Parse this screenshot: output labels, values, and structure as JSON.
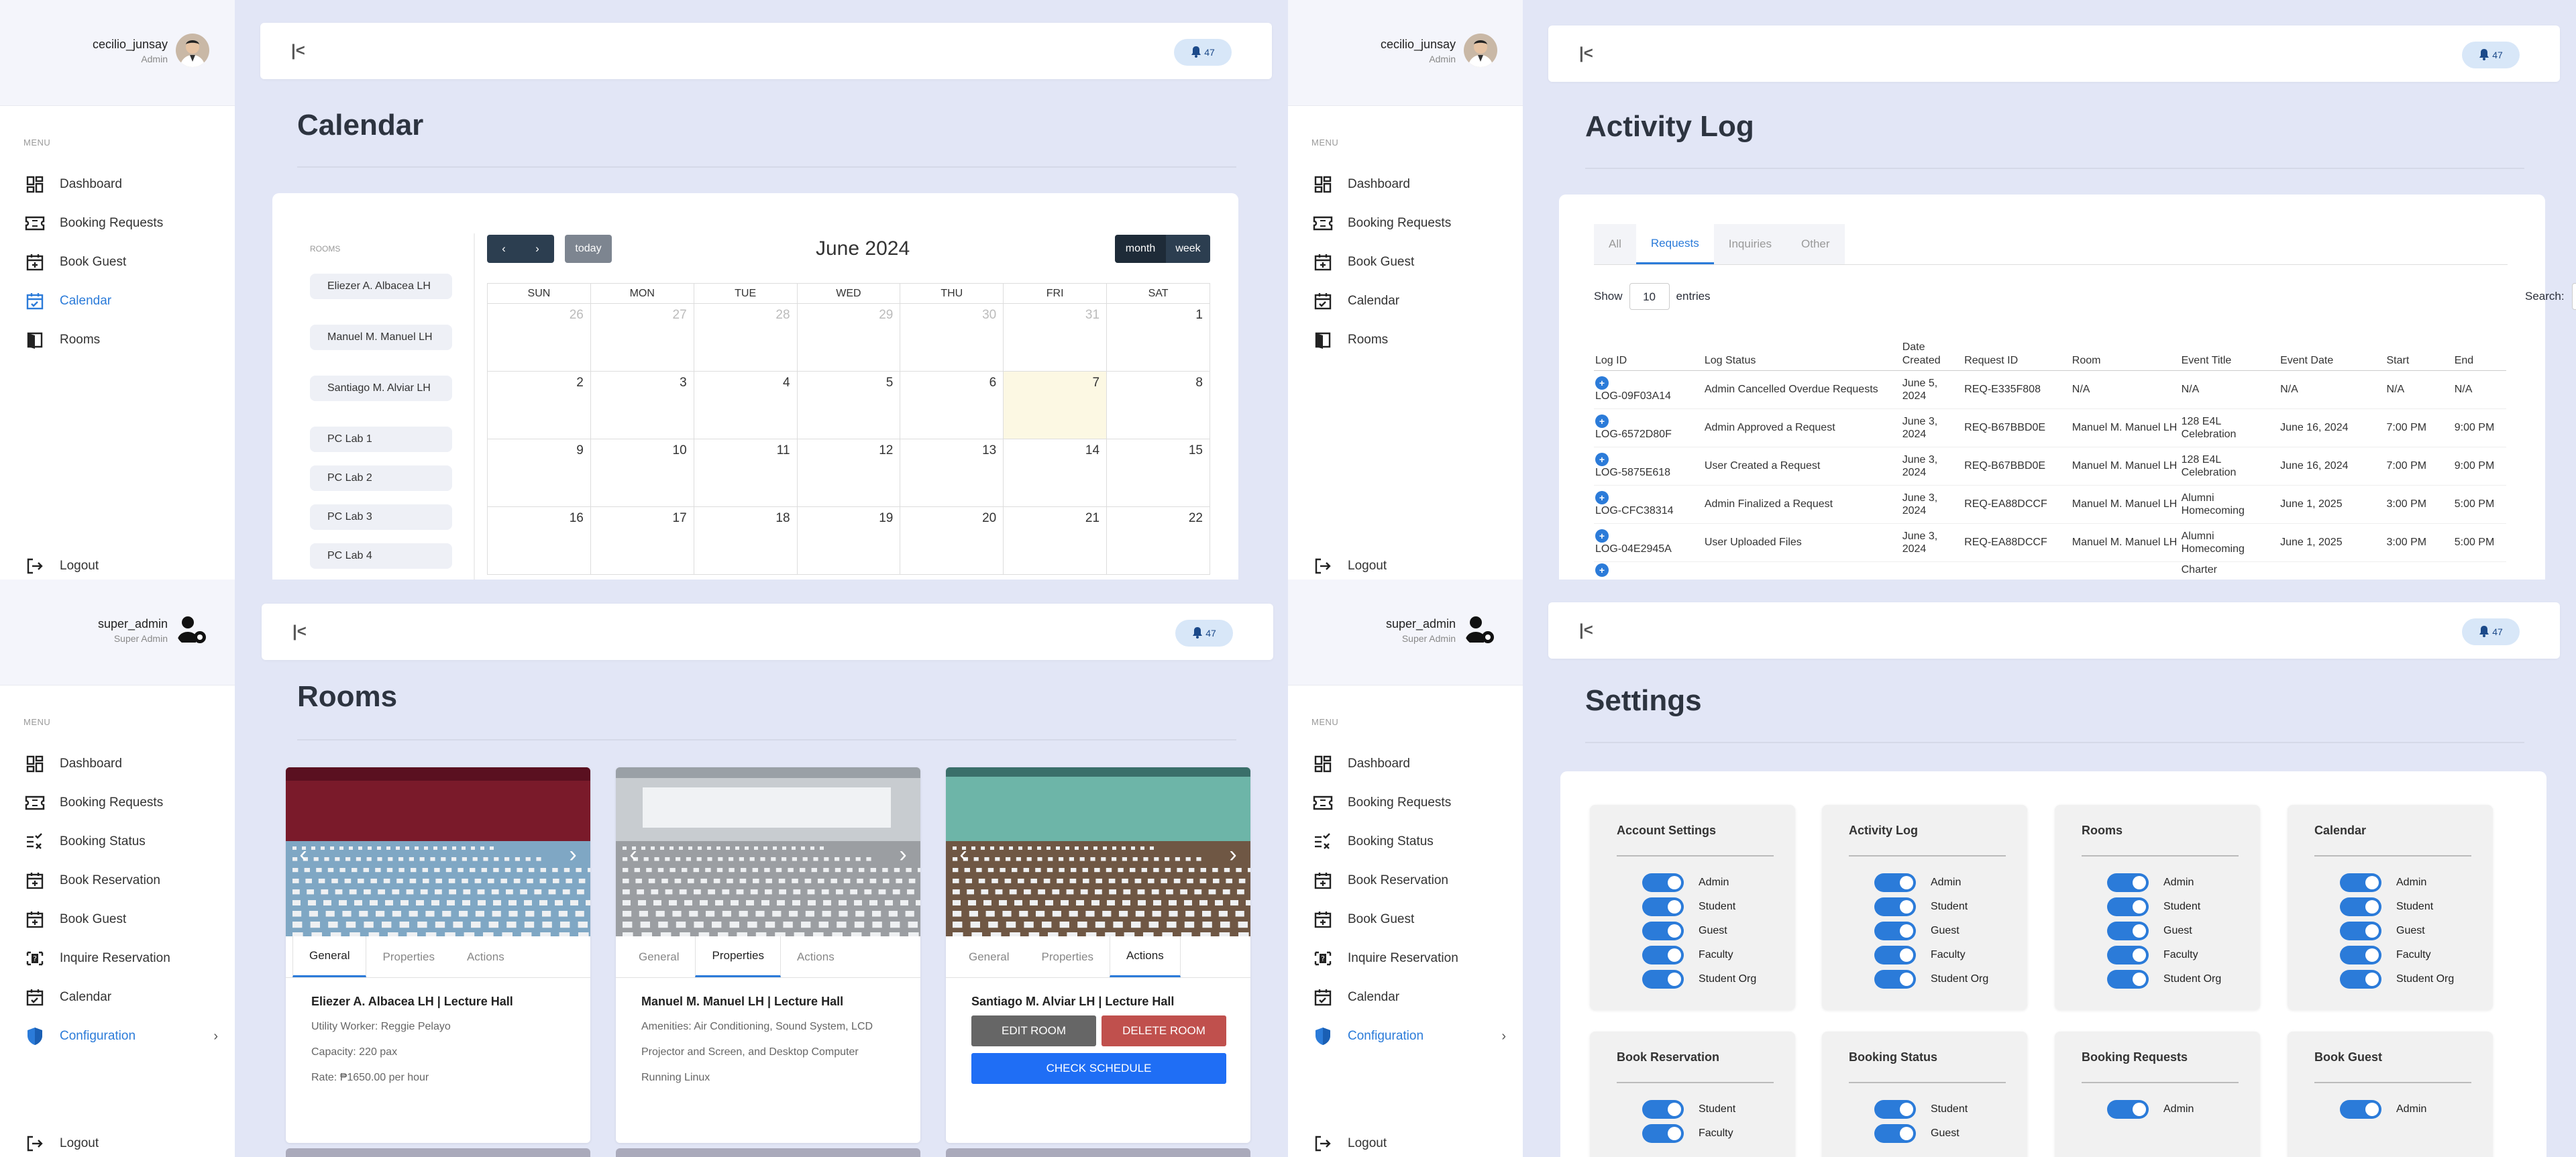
{
  "colors": {
    "accent": "#2b7bd9",
    "bg": "#e2e6f6",
    "today": "#fcf8e3",
    "edit": "#666666",
    "delete": "#c0504d",
    "schedule": "#1f6ef5"
  },
  "notifications": {
    "count": "47"
  },
  "users": {
    "admin": {
      "name": "cecilio_junsay",
      "role": "Admin"
    },
    "super": {
      "name": "super_admin",
      "role": "Super Admin"
    }
  },
  "menu_label": "MENU",
  "admin_menu": [
    "Dashboard",
    "Booking Requests",
    "Book Guest",
    "Calendar",
    "Rooms"
  ],
  "super_menu": [
    "Dashboard",
    "Booking Requests",
    "Booking Status",
    "Book Reservation",
    "Book Guest",
    "Inquire Reservation",
    "Calendar",
    "Configuration"
  ],
  "logout": "Logout",
  "calendar": {
    "title": "Calendar",
    "rooms_label": "ROOMS",
    "rooms": [
      "Eliezer A. Albacea LH",
      "Manuel M. Manuel LH",
      "Santiago M. Alviar LH",
      "PC Lab 1",
      "PC Lab 2",
      "PC Lab 3",
      "PC Lab 4"
    ],
    "today_label": "today",
    "month_title": "June 2024",
    "view_month": "month",
    "view_week": "week",
    "prev_icon": "chevron-left-icon",
    "next_icon": "chevron-right-icon",
    "days": [
      "SUN",
      "MON",
      "TUE",
      "WED",
      "THU",
      "FRI",
      "SAT"
    ],
    "weeks": [
      [
        "26",
        "27",
        "28",
        "29",
        "30",
        "31",
        "1"
      ],
      [
        "2",
        "3",
        "4",
        "5",
        "6",
        "7",
        "8"
      ],
      [
        "9",
        "10",
        "11",
        "12",
        "13",
        "14",
        "15"
      ],
      [
        "16",
        "17",
        "18",
        "19",
        "20",
        "21",
        "22"
      ]
    ],
    "today_date": "7"
  },
  "activity": {
    "title": "Activity Log",
    "tabs": [
      "All",
      "Requests",
      "Inquiries",
      "Other"
    ],
    "active_tab": "Requests",
    "show": "Show",
    "entries_value": "10",
    "entries": "entries",
    "search": "Search:",
    "columns": [
      "Log ID",
      "Log Status",
      "Date Created",
      "Request ID",
      "Room",
      "Event Title",
      "Event Date",
      "Start",
      "End"
    ],
    "rows": [
      [
        "LOG-09F03A14",
        "Admin Cancelled Overdue Requests",
        "June 5, 2024",
        "REQ-E335F808",
        "N/A",
        "N/A",
        "N/A",
        "N/A",
        "N/A"
      ],
      [
        "LOG-6572D80F",
        "Admin Approved a Request",
        "June 3, 2024",
        "REQ-B67BBD0E",
        "Manuel M. Manuel LH",
        "128 E4L Celebration",
        "June 16, 2024",
        "7:00 PM",
        "9:00 PM"
      ],
      [
        "LOG-5875E618",
        "User Created a Request",
        "June 3, 2024",
        "REQ-B67BBD0E",
        "Manuel M. Manuel LH",
        "128 E4L Celebration",
        "June 16, 2024",
        "7:00 PM",
        "9:00 PM"
      ],
      [
        "LOG-CFC38314",
        "Admin Finalized a Request",
        "June 3, 2024",
        "REQ-EA88DCCF",
        "Manuel M. Manuel LH",
        "Alumni Homecoming",
        "June 1, 2025",
        "3:00 PM",
        "5:00 PM"
      ],
      [
        "LOG-04E2945A",
        "User Uploaded Files",
        "June 3, 2024",
        "REQ-EA88DCCF",
        "Manuel M. Manuel LH",
        "Alumni Homecoming",
        "June 1, 2025",
        "3:00 PM",
        "5:00 PM"
      ]
    ],
    "partial": "Charter"
  },
  "rooms": {
    "title": "Rooms",
    "tabs": [
      "General",
      "Properties",
      "Actions"
    ],
    "cards": [
      {
        "name": "Eliezer A. Albacea LH | Lecture Hall",
        "active": "General",
        "lines": [
          "Utility Worker: Reggie Pelayo",
          "Capacity: 220 pax",
          "Rate: ₱1650.00 per hour"
        ]
      },
      {
        "name": "Manuel M. Manuel LH | Lecture Hall",
        "active": "Properties",
        "lines": [
          "Amenities: Air Conditioning, Sound System, LCD",
          "Projector and Screen, and Desktop Computer",
          "Running Linux"
        ]
      },
      {
        "name": "Santiago M. Alviar LH | Lecture Hall",
        "active": "Actions",
        "edit": "EDIT ROOM",
        "delete": "DELETE ROOM",
        "schedule": "CHECK SCHEDULE"
      }
    ]
  },
  "settings": {
    "title": "Settings",
    "cards": [
      {
        "title": "Account Settings",
        "items": [
          "Admin",
          "Student",
          "Guest",
          "Faculty",
          "Student Org"
        ]
      },
      {
        "title": "Activity Log",
        "items": [
          "Admin",
          "Student",
          "Guest",
          "Faculty",
          "Student Org"
        ]
      },
      {
        "title": "Rooms",
        "items": [
          "Admin",
          "Student",
          "Guest",
          "Faculty",
          "Student Org"
        ]
      },
      {
        "title": "Calendar",
        "items": [
          "Admin",
          "Student",
          "Guest",
          "Faculty",
          "Student Org"
        ]
      },
      {
        "title": "Book Reservation",
        "items": [
          "Student",
          "Faculty"
        ]
      },
      {
        "title": "Booking Status",
        "items": [
          "Student",
          "Guest"
        ]
      },
      {
        "title": "Booking Requests",
        "items": [
          "Admin"
        ]
      },
      {
        "title": "Book Guest",
        "items": [
          "Admin"
        ]
      }
    ]
  }
}
